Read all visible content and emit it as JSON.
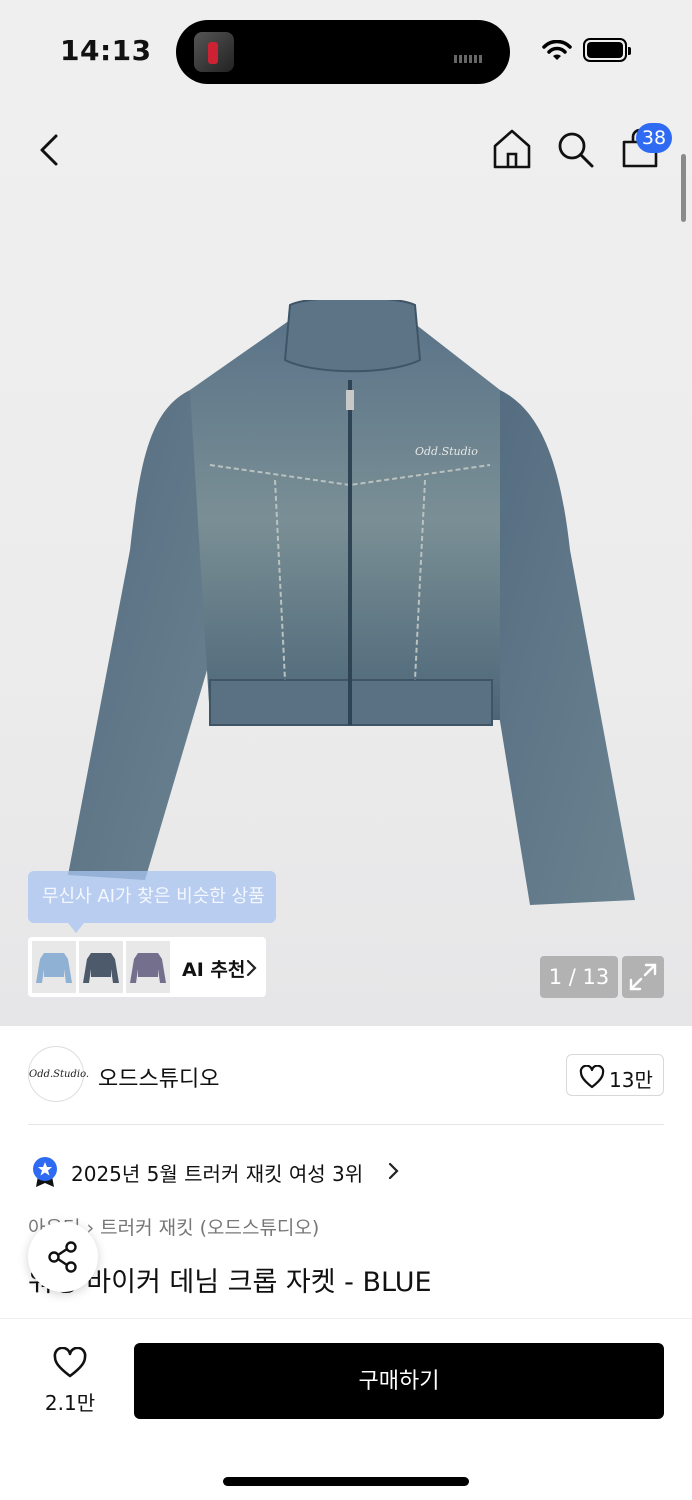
{
  "status_bar": {
    "time": "14:13"
  },
  "nav": {
    "back_icon": "chevron-left-icon",
    "home_icon": "home-icon",
    "search_icon": "search-icon",
    "cart_icon": "shopping-bag-icon",
    "cart_count": "38",
    "badge_color": "#2f6bf2"
  },
  "gallery": {
    "ai_tooltip": "무신사 AI가 찾은 비슷한 상품",
    "ai_recommend_label": "AI 추천",
    "image_counter": "1 / 13",
    "jacket_logo": "Odd.Studio"
  },
  "brand": {
    "logo_text": "Odd.Studio.",
    "name": "오드스튜디오",
    "like_count": "13만"
  },
  "ranking": {
    "text": "2025년 5월 트러커 재킷 여성 3위"
  },
  "product": {
    "category": "아우터 › 트러커 재킷 (오드스튜디오)",
    "title": "워싱 바이커 데님 크롭 자켓 - BLUE"
  },
  "bottom": {
    "wish_count": "2.1만",
    "buy_label": "구매하기"
  }
}
